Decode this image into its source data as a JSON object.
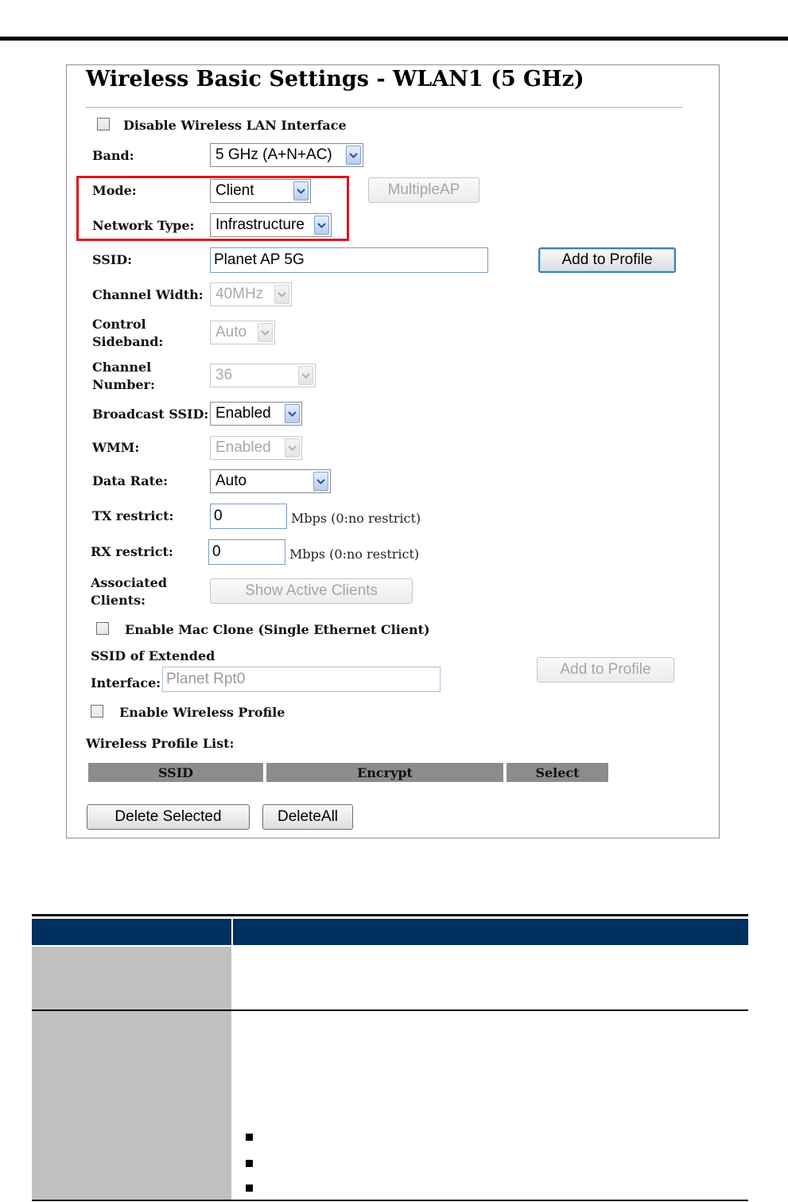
{
  "page": {
    "title": "Wireless Basic Settings - WLAN1 (5 GHz)"
  },
  "form": {
    "disable_wlan_label": "Disable Wireless LAN Interface",
    "band_label": "Band:",
    "band_value": "5 GHz (A+N+AC)",
    "mode_label": "Mode:",
    "mode_value": "Client",
    "multiple_ap_label": "MultipleAP",
    "network_type_label": "Network Type:",
    "network_type_value": "Infrastructure",
    "ssid_label": "SSID:",
    "ssid_value": "Planet AP 5G",
    "add_to_profile_label": "Add to Profile",
    "channel_width_label": "Channel Width:",
    "channel_width_value": "40MHz",
    "control_sideband_label_1": "Control",
    "control_sideband_label_2": "Sideband:",
    "control_sideband_value": "Auto",
    "channel_number_label_1": "Channel",
    "channel_number_label_2": "Number:",
    "channel_number_value": "36",
    "broadcast_ssid_label": "Broadcast SSID:",
    "broadcast_ssid_value": "Enabled",
    "wmm_label": "WMM:",
    "wmm_value": "Enabled",
    "data_rate_label": "Data Rate:",
    "data_rate_value": "Auto",
    "tx_restrict_label": "TX restrict:",
    "tx_restrict_value": "0",
    "tx_unit": "Mbps (0:no restrict)",
    "rx_restrict_label": "RX restrict:",
    "rx_restrict_value": "0",
    "rx_unit": "Mbps (0:no restrict)",
    "associated_clients_label_1": "Associated",
    "associated_clients_label_2": "Clients:",
    "show_active_clients_label": "Show Active Clients",
    "mac_clone_label": "Enable Mac Clone (Single Ethernet Client)",
    "ssid_extended_label_1": "SSID of Extended",
    "ssid_extended_label_2": "Interface:",
    "ssid_extended_value": "Planet Rpt0",
    "add_to_profile_2_label": "Add to Profile",
    "enable_profile_label": "Enable Wireless Profile",
    "profile_list_label": "Wireless Profile List:",
    "profile_columns": [
      "SSID",
      "Encrypt",
      "Select"
    ],
    "delete_selected_label": "Delete Selected",
    "delete_all_label": "DeleteAll"
  },
  "colors": {
    "highlight_box": "#e0161b",
    "table_header": "#00305f",
    "table_left_cell": "#c0c0c0"
  }
}
